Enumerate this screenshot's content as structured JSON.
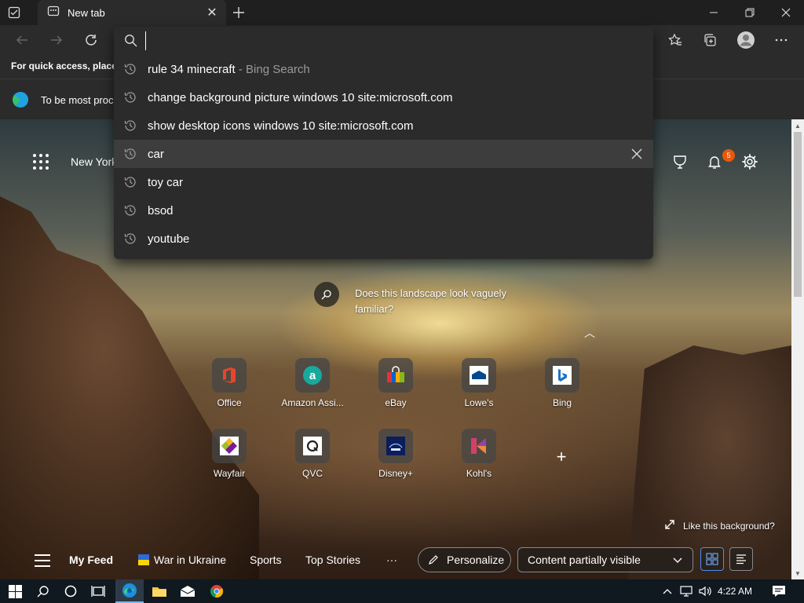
{
  "browser": {
    "tab_title": "New tab",
    "favorites_bar_text": "For quick access, place y",
    "infobar_text": "To be most proc"
  },
  "address_bar": {
    "value": "",
    "suggestions": [
      {
        "text": "rule 34 minecraft",
        "suffix": " - Bing Search"
      },
      {
        "text": "change background picture windows 10 site:microsoft.com",
        "suffix": ""
      },
      {
        "text": "show desktop icons windows 10 site:microsoft.com",
        "suffix": ""
      },
      {
        "text": "car",
        "suffix": ""
      },
      {
        "text": "toy car",
        "suffix": ""
      },
      {
        "text": "bsod",
        "suffix": ""
      },
      {
        "text": "youtube",
        "suffix": ""
      }
    ],
    "highlighted_index": 3
  },
  "page": {
    "weather_location": "New York",
    "notification_count": "5",
    "landscape_prompt": "Does this landscape look vaguely familiar?",
    "like_background": "Like this background?"
  },
  "quick_links": [
    {
      "label": "Office",
      "icon": "office-icon"
    },
    {
      "label": "Amazon Assi...",
      "icon": "amazon-icon"
    },
    {
      "label": "eBay",
      "icon": "ebay-icon"
    },
    {
      "label": "Lowe's",
      "icon": "lowes-icon"
    },
    {
      "label": "Bing",
      "icon": "bing-icon"
    },
    {
      "label": "Wayfair",
      "icon": "wayfair-icon"
    },
    {
      "label": "QVC",
      "icon": "qvc-icon"
    },
    {
      "label": "Disney+",
      "icon": "disney-icon"
    },
    {
      "label": "Kohl's",
      "icon": "kohls-icon"
    }
  ],
  "feed": {
    "my_feed": "My Feed",
    "war_in_ukraine": "War in Ukraine",
    "sports": "Sports",
    "top_stories": "Top Stories",
    "more": "···",
    "personalize": "Personalize",
    "content_visibility": "Content partially visible"
  },
  "taskbar": {
    "time": "4:22 AM"
  },
  "colors": {
    "accent": "#76b9ed",
    "badge": "#e8590c"
  }
}
